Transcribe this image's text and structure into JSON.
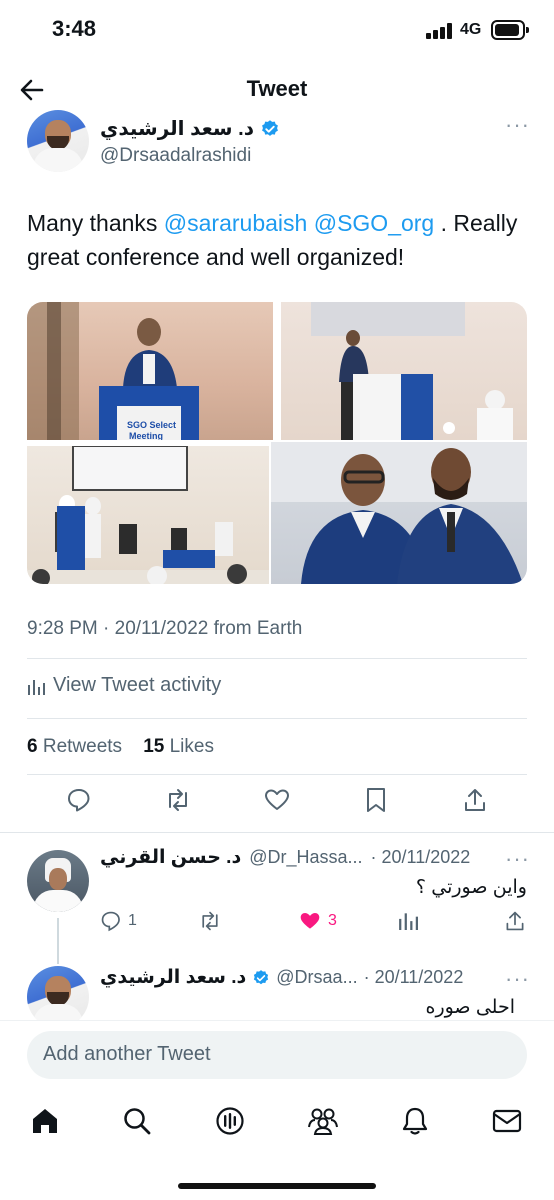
{
  "status_bar": {
    "time": "3:48",
    "network": "4G"
  },
  "header": {
    "title": "Tweet"
  },
  "tweet": {
    "author_name": "د. سعد الرشيدي",
    "author_handle": "@Drsaadalrashidi",
    "text_prefix": "Many thanks ",
    "mention_1": "@sararubaish",
    "mention_2": "@SGO_org",
    "text_suffix": " . Really great conference and well organized!",
    "photo_text": {
      "banner_1": "SGO Select",
      "banner_2": "Meeting"
    },
    "timestamp": "9:28 PM · 20/11/2022 from Earth",
    "activity_label": "View Tweet activity",
    "retweet_count": "6",
    "retweet_label": "Retweets",
    "like_count": "15",
    "like_label": "Likes"
  },
  "replies": [
    {
      "name": "د. حسن القرني",
      "handle": "@Dr_Hassa...",
      "date": "· 20/11/2022",
      "text": "واين صورتي ؟",
      "reply_count": "1",
      "like_count": "3"
    },
    {
      "name": "د. سعد الرشيدي",
      "handle": "@Drsaa...",
      "date": "· 20/11/2022",
      "text": "احلى صوره"
    }
  ],
  "compose": {
    "placeholder": "Add another Tweet"
  },
  "colors": {
    "accent": "#1d9bf0",
    "like": "#f91880",
    "text": "#0f1419",
    "muted": "#536471"
  },
  "tabs": [
    "home-icon",
    "search-icon",
    "spaces-icon",
    "communities-icon",
    "notifications-icon",
    "messages-icon"
  ]
}
